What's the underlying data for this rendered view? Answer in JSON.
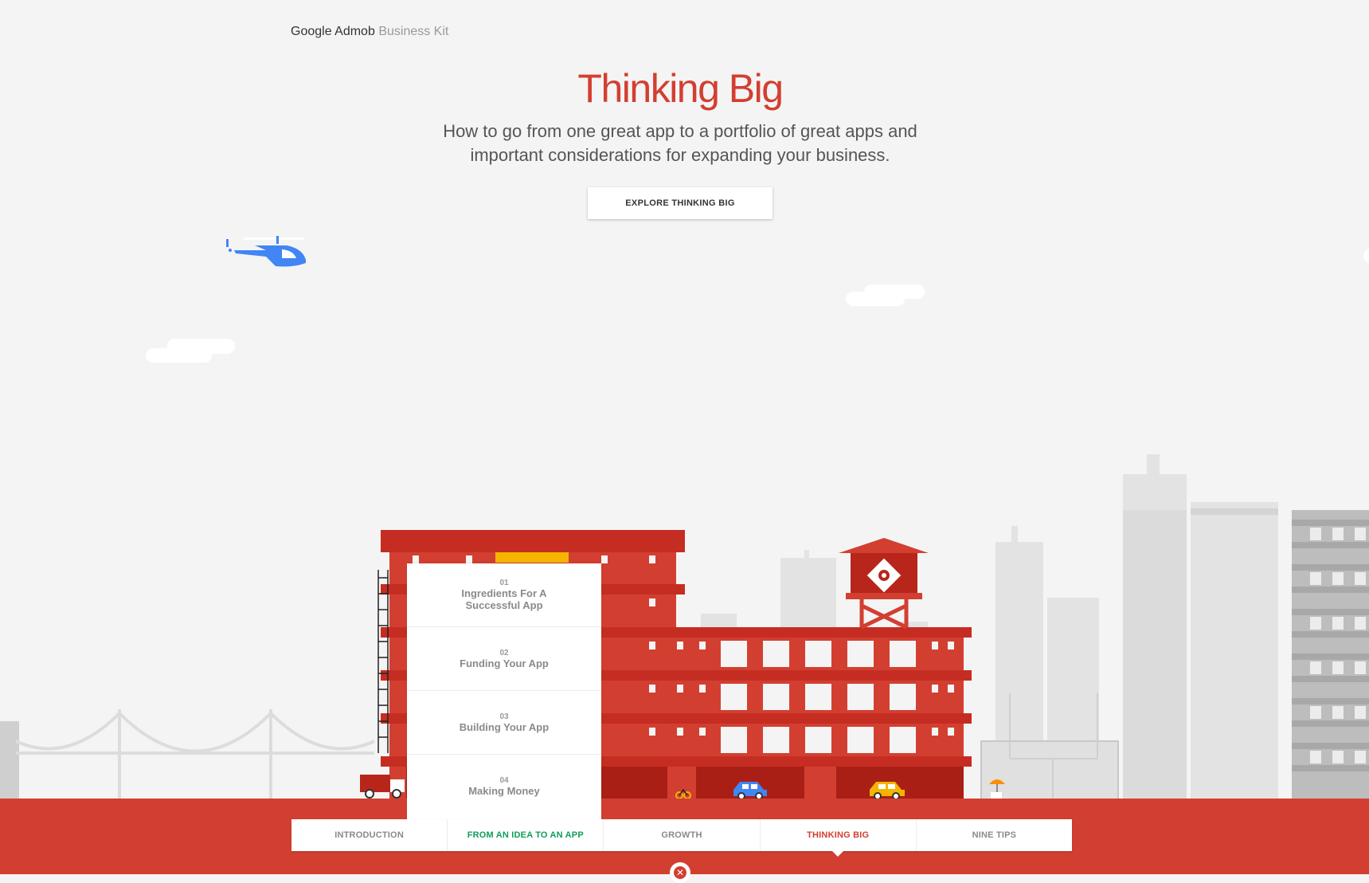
{
  "brand": {
    "name": "Google Admob",
    "sub": "Business Kit"
  },
  "hero": {
    "title": "Thinking Big",
    "subtitle_line1": "How to go from one great app to a portfolio of great apps and",
    "subtitle_line2": "important considerations for expanding your business.",
    "button_label": "EXPLORE THINKING BIG"
  },
  "chapters": [
    {
      "num": "01",
      "label": "Ingredients For A Successful App"
    },
    {
      "num": "02",
      "label": "Funding Your App"
    },
    {
      "num": "03",
      "label": "Building Your App"
    },
    {
      "num": "04",
      "label": "Making Money"
    }
  ],
  "nav": {
    "tabs": [
      {
        "label": "INTRODUCTION"
      },
      {
        "label": "FROM AN IDEA TO AN APP"
      },
      {
        "label": "GROWTH"
      },
      {
        "label": "THINKING BIG"
      },
      {
        "label": "NINE TIPS"
      }
    ],
    "active_tab": "THINKING BIG"
  },
  "close_icon": "close-icon",
  "colors": {
    "accent": "#d23f31",
    "dark_red": "#b8261b",
    "green": "#0f9d58",
    "helicopter": "#4285f4",
    "background": "#f4f4f4"
  },
  "icons": [
    "helicopter-icon",
    "truck-icon",
    "car-icon",
    "taxi-icon",
    "bicycle-icon",
    "umbrella-icon"
  ]
}
